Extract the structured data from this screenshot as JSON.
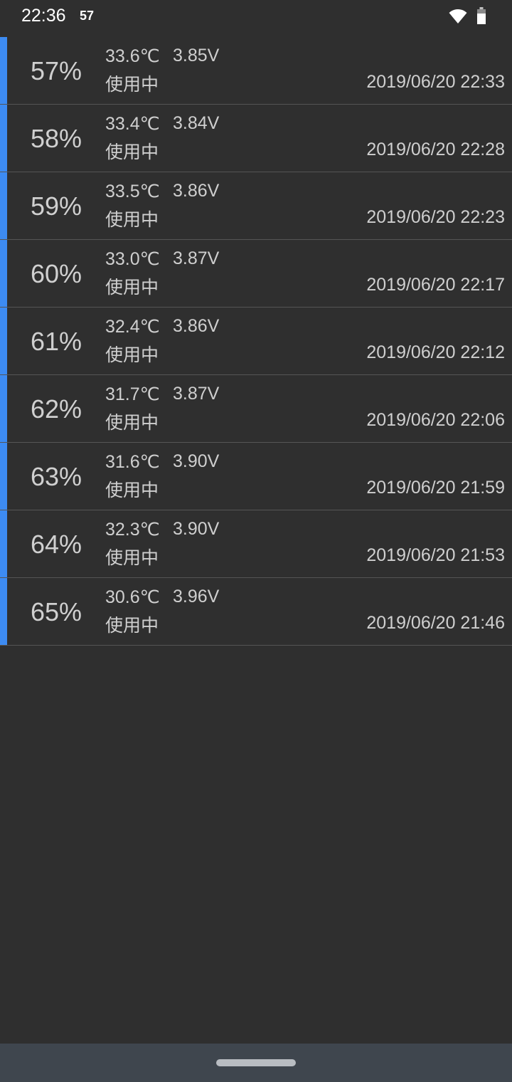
{
  "status_bar": {
    "time": "22:36",
    "notification": "57",
    "icons": [
      "wifi-icon",
      "battery-icon"
    ]
  },
  "colors": {
    "accent": "#3d8bf2",
    "background": "#2f2f2f",
    "nav_bar": "#3f464e"
  },
  "history": [
    {
      "percent": "57%",
      "temperature": "33.6℃",
      "voltage": "3.85V",
      "status": "使用中",
      "datetime": "2019/06/20 22:33"
    },
    {
      "percent": "58%",
      "temperature": "33.4℃",
      "voltage": "3.84V",
      "status": "使用中",
      "datetime": "2019/06/20 22:28"
    },
    {
      "percent": "59%",
      "temperature": "33.5℃",
      "voltage": "3.86V",
      "status": "使用中",
      "datetime": "2019/06/20 22:23"
    },
    {
      "percent": "60%",
      "temperature": "33.0℃",
      "voltage": "3.87V",
      "status": "使用中",
      "datetime": "2019/06/20 22:17"
    },
    {
      "percent": "61%",
      "temperature": "32.4℃",
      "voltage": "3.86V",
      "status": "使用中",
      "datetime": "2019/06/20 22:12"
    },
    {
      "percent": "62%",
      "temperature": "31.7℃",
      "voltage": "3.87V",
      "status": "使用中",
      "datetime": "2019/06/20 22:06"
    },
    {
      "percent": "63%",
      "temperature": "31.6℃",
      "voltage": "3.90V",
      "status": "使用中",
      "datetime": "2019/06/20 21:59"
    },
    {
      "percent": "64%",
      "temperature": "32.3℃",
      "voltage": "3.90V",
      "status": "使用中",
      "datetime": "2019/06/20 21:53"
    },
    {
      "percent": "65%",
      "temperature": "30.6℃",
      "voltage": "3.96V",
      "status": "使用中",
      "datetime": "2019/06/20 21:46"
    }
  ]
}
